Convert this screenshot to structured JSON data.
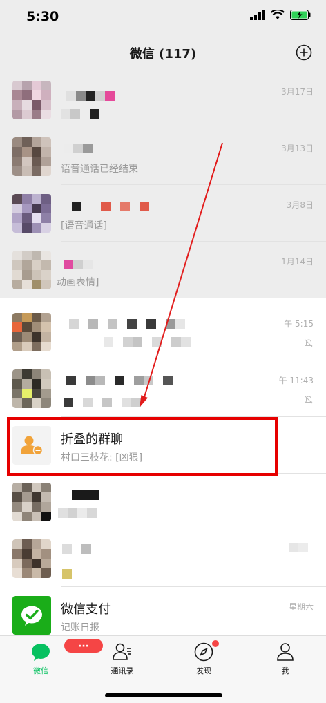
{
  "status_bar": {
    "time": "5:30"
  },
  "nav": {
    "title": "微信 (117)"
  },
  "chats": [
    {
      "name": "",
      "preview": "",
      "time": "3月17日"
    },
    {
      "name": "",
      "preview": "语音通话已经结束",
      "time": "3月13日"
    },
    {
      "name": "",
      "preview": "[语音通话]",
      "time": "3月8日"
    },
    {
      "name": "",
      "preview": "动画表情]",
      "time": "1月14日"
    },
    {
      "name": "",
      "preview": "",
      "time": "午 5:15"
    },
    {
      "name": "",
      "preview": "",
      "time": "午 11:43"
    },
    {
      "name": "折叠的群聊",
      "preview": "村口三枝花: [凶狠]",
      "time": ""
    },
    {
      "name": "",
      "preview": "",
      "time": ""
    },
    {
      "name": "",
      "preview": "",
      "time": ""
    },
    {
      "name": "微信支付",
      "preview": "记账日报",
      "time": "星期六"
    }
  ],
  "tabs": [
    {
      "label": "微信",
      "icon": "chat-bubble-icon",
      "badge": "···"
    },
    {
      "label": "通讯录",
      "icon": "contacts-icon"
    },
    {
      "label": "发现",
      "icon": "compass-icon"
    },
    {
      "label": "我",
      "icon": "person-icon"
    }
  ],
  "colors": {
    "accent": "#07c160",
    "badge": "#f54545",
    "highlight": "#e60000",
    "pay_green": "#1aad19"
  }
}
